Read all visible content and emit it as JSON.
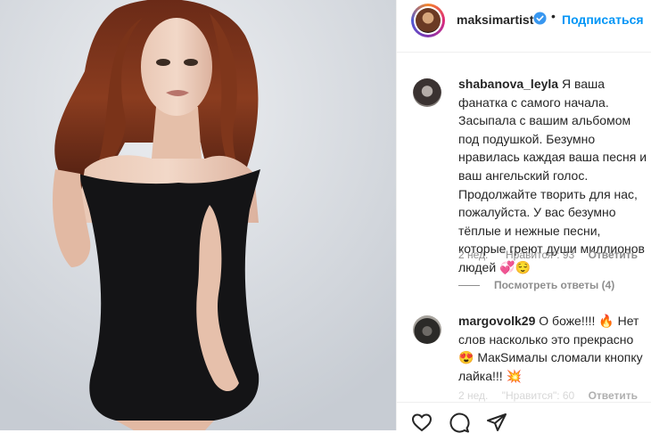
{
  "post": {
    "username": "maksimartist",
    "dot": "•",
    "follow_label": "Подписаться"
  },
  "comments": [
    {
      "username": "shabanova_leyla",
      "text": "Я ваша фанатка с самого начала. Засыпала с вашим альбомом под подушкой. Безумно нравилась каждая ваша песня и ваш ангельский голос. Продолжайте творить для нас, пожалуйста. У вас безумно тёплые и нежные песни, которые греют души миллионов людей 💞😌",
      "time": "2 нед.",
      "likes": "\"Нравится\": 93",
      "reply": "Ответить"
    },
    {
      "username": "margovolk29",
      "text": "О боже!!!! 🔥 Нет слов насколько это прекрасно 😍 МакSималы сломали кнопку лайка!!! 💥",
      "time": "2 нед.",
      "likes": "\"Нравится\": 60",
      "reply": "Ответить"
    }
  ],
  "view_replies": "Посмотреть ответы (4)",
  "icons": {
    "verified": "verified-badge-icon",
    "like": "heart-icon",
    "comment": "comment-icon",
    "share": "paper-plane-icon"
  },
  "colors": {
    "accent": "#0095f6",
    "muted": "#8e8e8e",
    "text": "#262626"
  }
}
